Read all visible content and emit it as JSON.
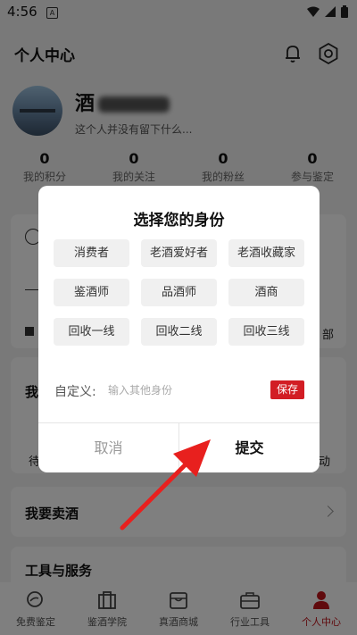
{
  "status_bar": {
    "time": "4:56",
    "indicator": "A"
  },
  "header": {
    "title": "个人中心",
    "icons": [
      "bell-icon",
      "settings-icon"
    ]
  },
  "profile": {
    "name": "酒",
    "bio": "这个人并没有留下什么..."
  },
  "stats": [
    {
      "value": "0",
      "label": "我的积分"
    },
    {
      "value": "0",
      "label": "我的关注"
    },
    {
      "value": "0",
      "label": "我的粉丝"
    },
    {
      "value": "0",
      "label": "参与鉴定"
    }
  ],
  "sections": {
    "partial_a": "我",
    "partial_b": "待",
    "partial_c": "动",
    "partial_d": "部",
    "sell_wine": "我要卖酒",
    "tools": "工具与服务"
  },
  "tabs": [
    {
      "label": "免费鉴定",
      "icon": "search-icon"
    },
    {
      "label": "鉴酒学院",
      "icon": "academy-icon"
    },
    {
      "label": "真酒商城",
      "icon": "store-icon"
    },
    {
      "label": "行业工具",
      "icon": "briefcase-icon"
    },
    {
      "label": "个人中心",
      "icon": "person-icon",
      "active": true
    }
  ],
  "dialog": {
    "title": "选择您的身份",
    "options": [
      "消费者",
      "老酒爱好者",
      "老酒收藏家",
      "鉴酒师",
      "品酒师",
      "酒商",
      "回收一线",
      "回收二线",
      "回收三线"
    ],
    "custom_label": "自定义:",
    "custom_placeholder": "输入其他身份",
    "save": "保存",
    "cancel": "取消",
    "submit": "提交"
  },
  "colors": {
    "accent": "#d21d24",
    "overlay": "rgba(0,0,0,0.5)"
  }
}
